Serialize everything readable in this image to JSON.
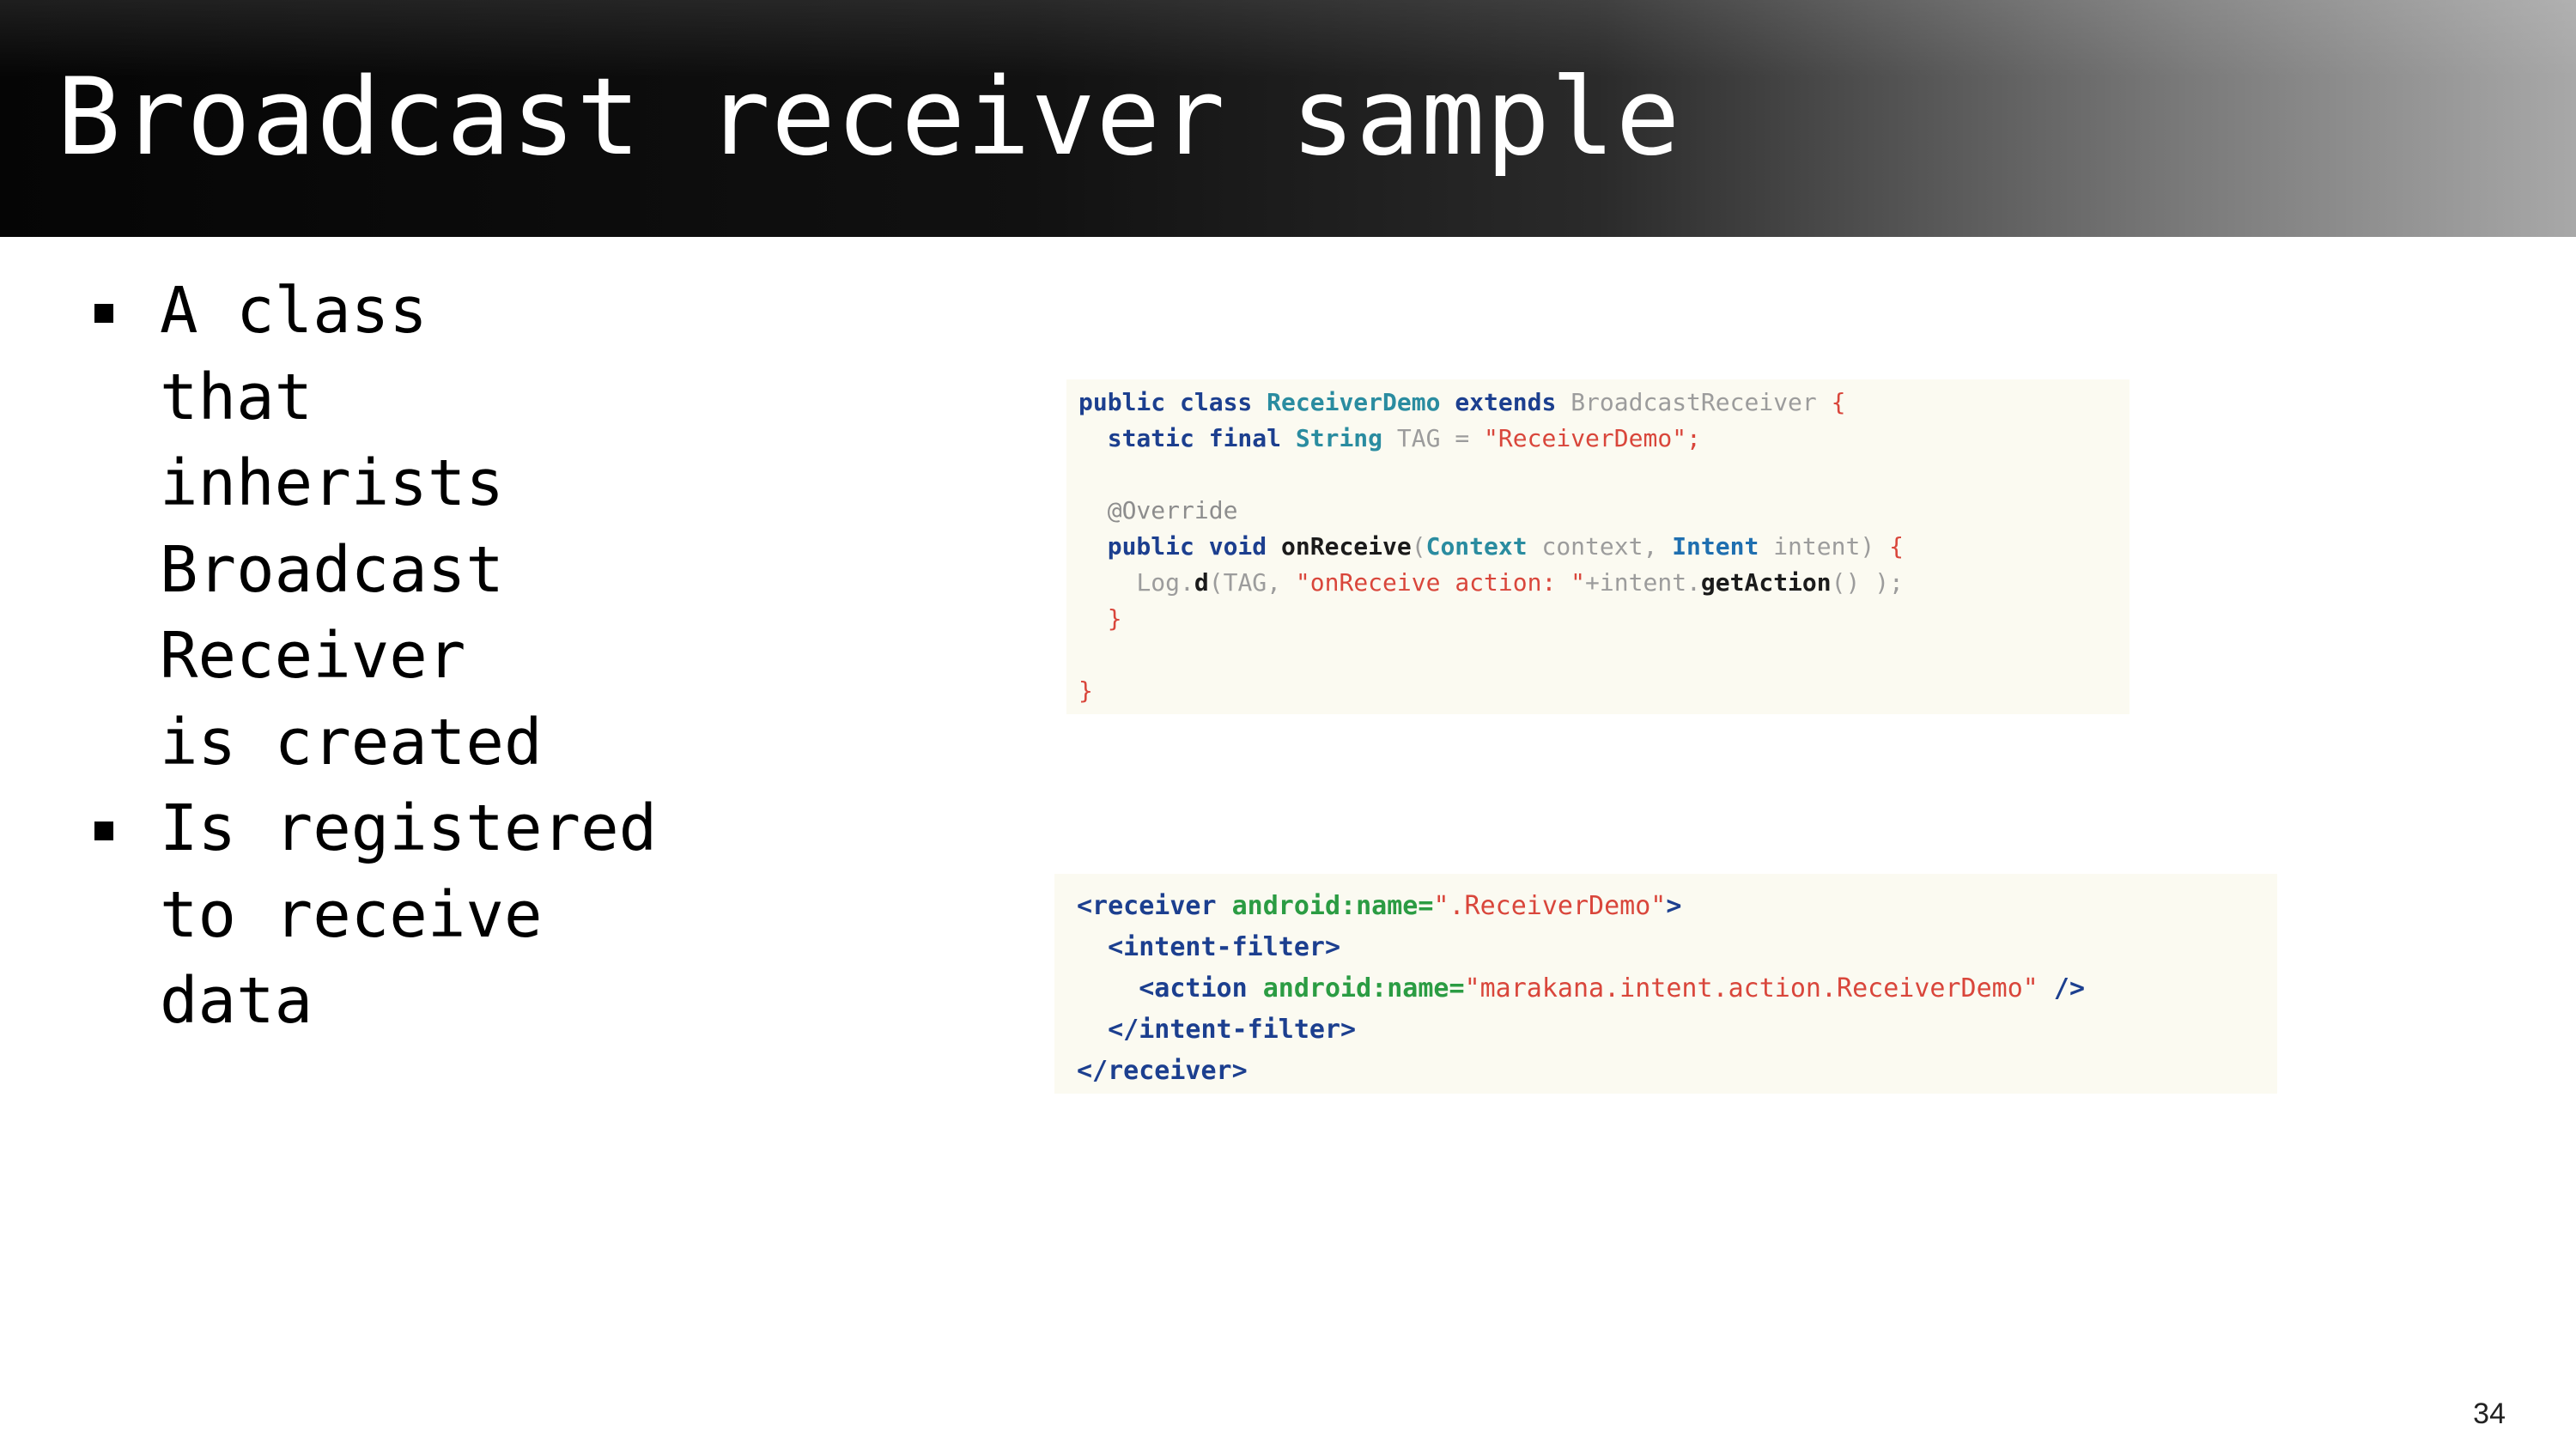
{
  "slide": {
    "title": "Broadcast receiver sample",
    "bullets": [
      {
        "lines": [
          "A class",
          "that",
          "inherists",
          "Broadcast",
          "Receiver",
          "is created"
        ]
      },
      {
        "lines": [
          "Is registered",
          "to receive",
          "data"
        ]
      }
    ],
    "page_number": "34"
  },
  "code_java": {
    "l1": {
      "t1": "public class",
      "t2": "ReceiverDemo",
      "t3": "extends",
      "t4": "BroadcastReceiver",
      "t5": "{"
    },
    "l2": {
      "t1": "static final",
      "t2": "String",
      "t3": "TAG =",
      "t4": "\"ReceiverDemo\";"
    },
    "l4": {
      "t1": "@Override"
    },
    "l5": {
      "t1": "public void",
      "t2": "onReceive",
      "t3": "(",
      "t4": "Context",
      "t5": "context,",
      "t6": "Intent",
      "t7": "intent)",
      "t8": "{"
    },
    "l6": {
      "t1": "Log.",
      "t2": "d",
      "t3": "(TAG,",
      "t4": "\"onReceive action: \"",
      "t5": "+intent.",
      "t6": "getAction",
      "t7": "() );"
    },
    "l7": {
      "t1": "}"
    },
    "l9": {
      "t1": "}"
    }
  },
  "code_xml": {
    "l1": {
      "t1": "<receiver",
      "t2": "android:name=",
      "t3": "\".ReceiverDemo\"",
      "t4": ">"
    },
    "l2": {
      "t1": "<intent-filter>"
    },
    "l3": {
      "t1": "<action",
      "t2": "android:name=",
      "t3": "\"marakana.intent.action.ReceiverDemo\"",
      "t4": "/>"
    },
    "l4": {
      "t1": "</intent-filter>"
    },
    "l5": {
      "t1": "</receiver>"
    }
  }
}
